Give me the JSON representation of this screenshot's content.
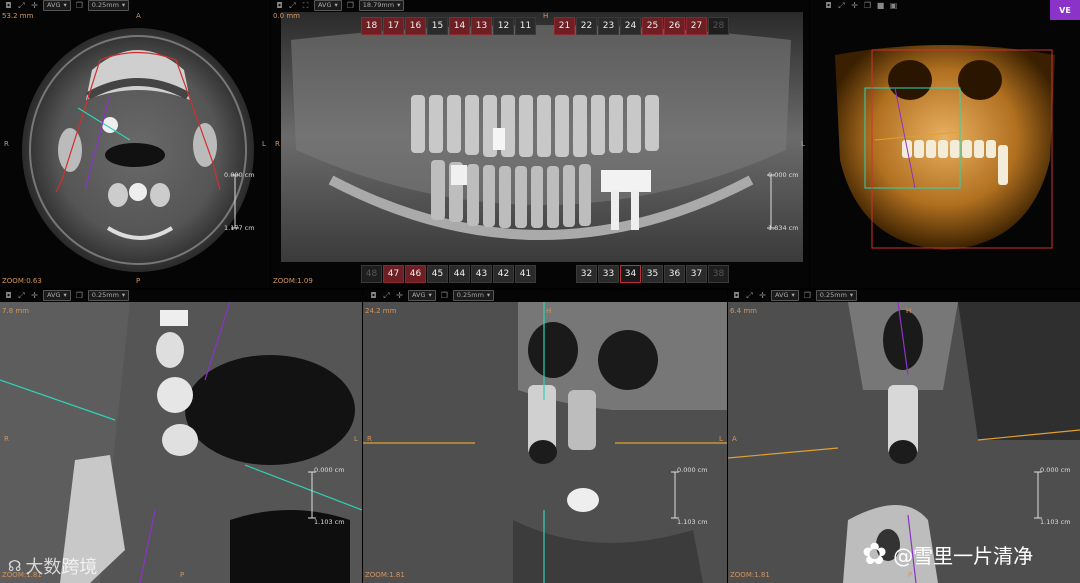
{
  "toolbar": {
    "avg": "AVG",
    "thickness": "0.25mm",
    "thickness_pano": "18.79mm"
  },
  "vr_button": "VE",
  "axial": {
    "depth": "53.2 mm",
    "top": "A",
    "bottom": "P",
    "left": "R",
    "right": "L",
    "zoom": "ZOOM:0.63",
    "scale_top": "0.000 cm",
    "scale_bottom": "1.177 cm"
  },
  "pano": {
    "depth": "0.0 mm",
    "top": "H",
    "left": "R",
    "right": "L",
    "zoom": "ZOOM:1.09",
    "scale_top": "0.000 cm",
    "scale_bottom": "1.834 cm",
    "upper_teeth": [
      {
        "n": "18",
        "s": "sel"
      },
      {
        "n": "17",
        "s": "sel"
      },
      {
        "n": "16",
        "s": "sel"
      },
      {
        "n": "15",
        "s": "norm"
      },
      {
        "n": "14",
        "s": "sel"
      },
      {
        "n": "13",
        "s": "sel"
      },
      {
        "n": "12",
        "s": "norm"
      },
      {
        "n": "11",
        "s": "norm"
      }
    ],
    "upper_teeth_right": [
      {
        "n": "21",
        "s": "sel"
      },
      {
        "n": "22",
        "s": "norm"
      },
      {
        "n": "23",
        "s": "norm"
      },
      {
        "n": "24",
        "s": "norm"
      },
      {
        "n": "25",
        "s": "sel"
      },
      {
        "n": "26",
        "s": "sel"
      },
      {
        "n": "27",
        "s": "sel"
      },
      {
        "n": "28",
        "s": "dim"
      }
    ],
    "lower_teeth": [
      {
        "n": "48",
        "s": "dim"
      },
      {
        "n": "47",
        "s": "sel"
      },
      {
        "n": "46",
        "s": "sel"
      },
      {
        "n": "45",
        "s": "norm"
      },
      {
        "n": "44",
        "s": "norm"
      },
      {
        "n": "43",
        "s": "norm"
      },
      {
        "n": "42",
        "s": "norm"
      },
      {
        "n": "41",
        "s": "norm"
      }
    ],
    "lower_teeth_right": [
      {
        "n": "32",
        "s": "norm"
      },
      {
        "n": "33",
        "s": "norm"
      },
      {
        "n": "34",
        "s": "hi"
      },
      {
        "n": "35",
        "s": "norm"
      },
      {
        "n": "36",
        "s": "norm"
      },
      {
        "n": "37",
        "s": "norm"
      },
      {
        "n": "38",
        "s": "dim"
      }
    ]
  },
  "cross1": {
    "depth": "7.8 mm",
    "left": "R",
    "right": "L",
    "bottom": "P",
    "zoom": "ZOOM:1.81",
    "scale_top": "0.000 cm",
    "scale_bottom": "1.103 cm"
  },
  "cross2": {
    "depth": "24.2 mm",
    "top": "H",
    "left": "R",
    "right": "L",
    "zoom": "ZOOM:1.81",
    "scale_top": "0.000 cm",
    "scale_bottom": "1.103 cm"
  },
  "cross3": {
    "depth": "6.4 mm",
    "top": "H",
    "left": "A",
    "zoom": "ZOOM:1.81",
    "bottom": "P",
    "scale_top": "0.000 cm",
    "scale_bottom": "1.103 cm"
  },
  "watermarks": {
    "left": "大数跨境",
    "right": "@雪里一片清净"
  },
  "colors": {
    "accent_red": "#6e1f24",
    "cyan_line": "#2fd3b5",
    "orange_line": "#e0a030",
    "purple_line": "#8b33c8"
  }
}
